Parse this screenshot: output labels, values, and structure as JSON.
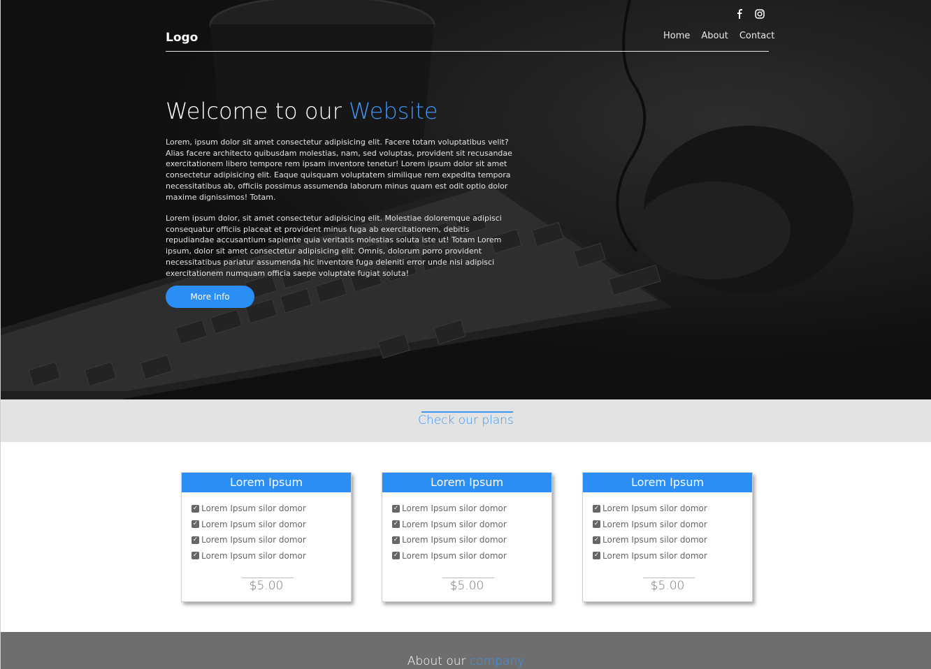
{
  "header": {
    "logo": "Logo",
    "nav": [
      "Home",
      "About",
      "Contact"
    ],
    "social_icons": [
      "facebook-icon",
      "instagram-icon"
    ]
  },
  "hero": {
    "title_main": "Welcome to our ",
    "title_accent": "Website",
    "paragraph1": "Lorem, ipsum dolor sit amet consectetur adipisicing elit. Facere totam voluptatibus velit? Alias facere architecto quibusdam molestias, nam, sed voluptas, provident sit recusandae exercitationem libero tempore rem ipsam inventore tenetur! Lorem ipsum dolor sit amet consectetur adipisicing elit. Eaque quisquam voluptatem similique rem expedita tempora necessitatibus ab, officiis possimus assumenda laborum minus quam est odit optio dolor maxime dignissimos! Totam.",
    "paragraph2": "Lorem ipsum dolor, sit amet consectetur adipisicing elit. Molestiae doloremque adipisci consequatur officiis placeat et provident minus fuga ab exercitationem, debitis repudiandae accusantium sapiente quia veritatis molestias soluta iste ut! Totam Lorem ipsum, dolor sit amet consectetur adipisicing elit. Omnis, dolorum porro provident necessitatibus pariatur assumenda hic inventore fuga deleniti error unde nisi adipisci exercitationem numquam officia saepe voluptate fugiat soluta!",
    "button": "More Info"
  },
  "plans": {
    "title": "Check our plans",
    "cards": [
      {
        "title": "Lorem Ipsum",
        "features": [
          "Lorem Ipsum silor domor",
          "Lorem Ipsum silor domor",
          "Lorem Ipsum silor domor",
          "Lorem Ipsum silor domor"
        ],
        "price": "$5.00"
      },
      {
        "title": "Lorem Ipsum",
        "features": [
          "Lorem Ipsum silor domor",
          "Lorem Ipsum silor domor",
          "Lorem Ipsum silor domor",
          "Lorem Ipsum silor domor"
        ],
        "price": "$5.00"
      },
      {
        "title": "Lorem Ipsum",
        "features": [
          "Lorem Ipsum silor domor",
          "Lorem Ipsum silor domor",
          "Lorem Ipsum silor domor",
          "Lorem Ipsum silor domor"
        ],
        "price": "$5.00"
      }
    ]
  },
  "about": {
    "title_main": "About our ",
    "title_accent": "company"
  },
  "colors": {
    "accent": "#2b8ef5",
    "plans_band": "#e3e3e3",
    "about_band": "#6e6e6e"
  }
}
